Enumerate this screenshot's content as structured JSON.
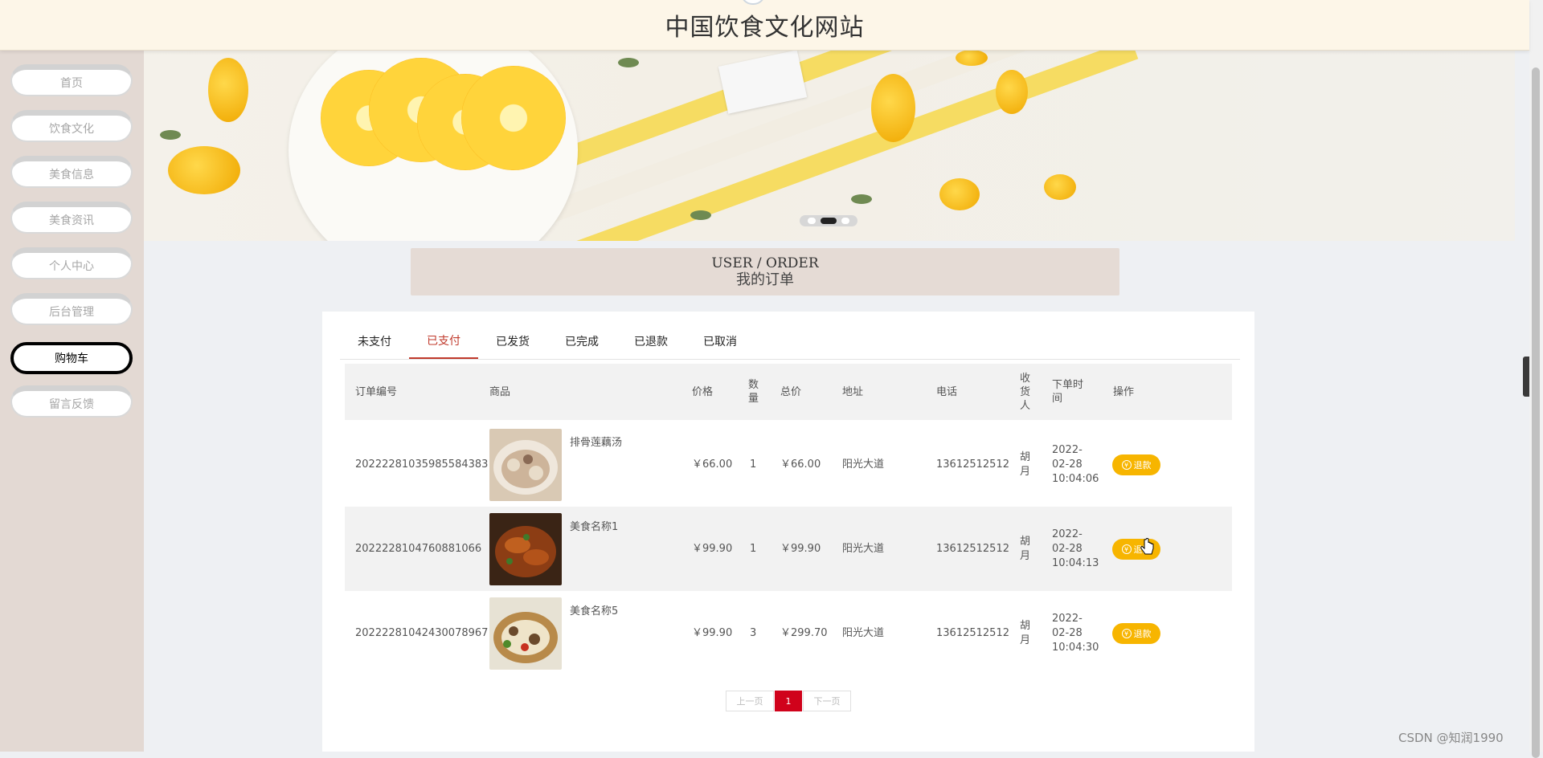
{
  "site": {
    "title": "中国饮食文化网站"
  },
  "sidebar": {
    "items": [
      {
        "label": "首页"
      },
      {
        "label": "饮食文化"
      },
      {
        "label": "美食信息"
      },
      {
        "label": "美食资讯"
      },
      {
        "label": "个人中心"
      },
      {
        "label": "后台管理"
      },
      {
        "label": "购物车",
        "active": true
      },
      {
        "label": "留言反馈"
      }
    ]
  },
  "banner": {
    "slides": 3,
    "active_slide": 2
  },
  "section": {
    "en": "USER / ORDER",
    "cn": "我的订单"
  },
  "tabs": [
    {
      "label": "未支付"
    },
    {
      "label": "已支付",
      "active": true
    },
    {
      "label": "已发货"
    },
    {
      "label": "已完成"
    },
    {
      "label": "已退款"
    },
    {
      "label": "已取消"
    }
  ],
  "table": {
    "headers": {
      "order_no": "订单编号",
      "product": "商品",
      "price": "价格",
      "qty": "数量",
      "total": "总价",
      "address": "地址",
      "phone": "电话",
      "receiver": "收货人",
      "time": "下单时间",
      "action": "操作"
    },
    "rows": [
      {
        "order_no": "20222281035985584383",
        "product": "排骨莲藕汤",
        "price": "￥66.00",
        "qty": "1",
        "total": "￥66.00",
        "address": "阳光大道",
        "phone": "13612512512",
        "receiver": "胡月",
        "time": "2022-02-28 10:04:06",
        "action": "退款"
      },
      {
        "order_no": "20222281047608810 66",
        "product": "美食名称1",
        "price": "￥99.90",
        "qty": "1",
        "total": "￥99.90",
        "address": "阳光大道",
        "phone": "13612512512",
        "receiver": "胡月",
        "time": "2022-02-28 10:04:13",
        "action": "退款"
      },
      {
        "order_no": "20222281042430078967",
        "product": "美食名称5",
        "price": "￥99.90",
        "qty": "3",
        "total": "￥299.70",
        "address": "阳光大道",
        "phone": "13612512512",
        "receiver": "胡月",
        "time": "2022-02-28 10:04:30",
        "action": "退款"
      }
    ]
  },
  "pagination": {
    "prev": "上一页",
    "current": "1",
    "next": "下一页"
  },
  "watermark": "CSDN @知润1990",
  "colors": {
    "accent": "#c0392b",
    "refund": "#f7b500",
    "page_active": "#d0021b"
  }
}
